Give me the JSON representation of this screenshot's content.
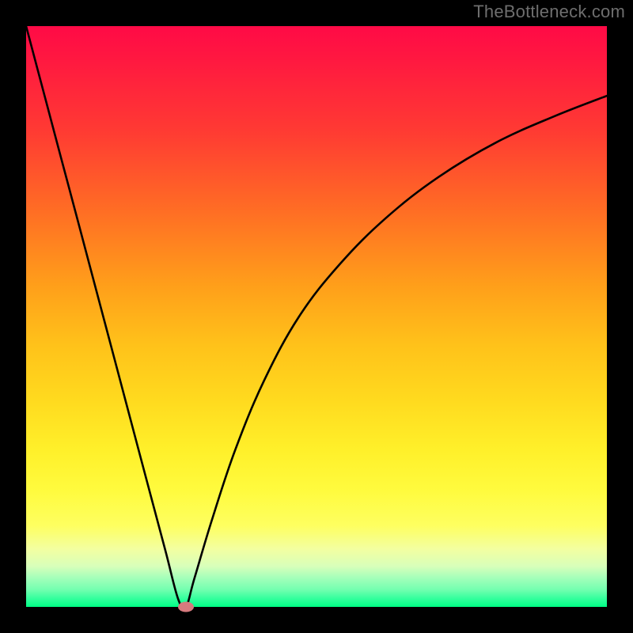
{
  "watermark": "TheBottleneck.com",
  "colors": {
    "frame": "#000000",
    "gradient_top": "#ff0a46",
    "gradient_bottom": "#00ff85",
    "curve": "#000000",
    "marker": "#d77a7e",
    "watermark_text": "#6e6e6e"
  },
  "chart_data": {
    "type": "line",
    "title": "",
    "xlabel": "",
    "ylabel": "",
    "xlim": [
      0,
      1
    ],
    "ylim": [
      0,
      1
    ],
    "annotations": [
      "TheBottleneck.com"
    ],
    "series": [
      {
        "name": "curve",
        "comment": "V-shaped curve; y is plotted with 0 at bottom. Left branch is near-linear, right branch is concave (sqrt-like).",
        "x": [
          0.0,
          0.03,
          0.06,
          0.09,
          0.12,
          0.15,
          0.18,
          0.21,
          0.24,
          0.262,
          0.275,
          0.29,
          0.32,
          0.36,
          0.41,
          0.47,
          0.54,
          0.62,
          0.71,
          0.81,
          0.91,
          1.0
        ],
        "y": [
          1.0,
          0.887,
          0.774,
          0.661,
          0.548,
          0.435,
          0.322,
          0.209,
          0.096,
          0.013,
          0.0,
          0.05,
          0.15,
          0.27,
          0.39,
          0.5,
          0.59,
          0.67,
          0.74,
          0.8,
          0.845,
          0.88
        ]
      }
    ],
    "marker": {
      "x": 0.275,
      "y": 0.0,
      "label": ""
    }
  },
  "geometry": {
    "plot_left": 33,
    "plot_top": 33,
    "plot_size": 734
  }
}
